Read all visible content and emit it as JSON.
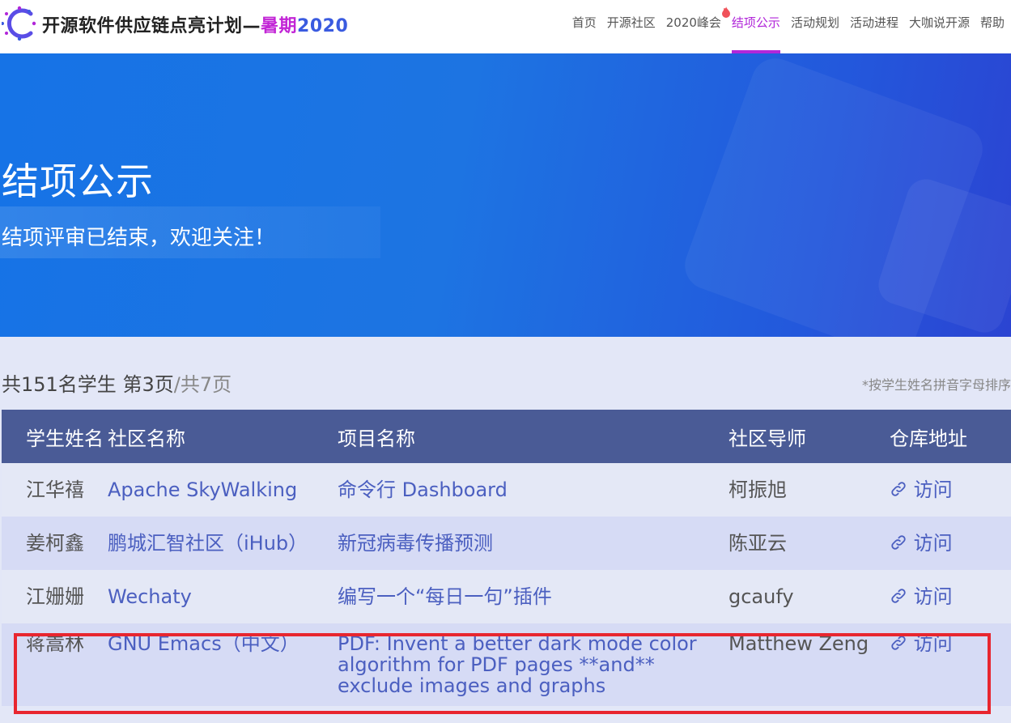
{
  "header": {
    "title_main": "开源软件供应链点亮计划",
    "title_dash": "—",
    "title_season": "暑期",
    "title_year": "2020",
    "nav": [
      {
        "label": "首页",
        "active": false
      },
      {
        "label": "开源社区",
        "active": false
      },
      {
        "label": "2020峰会",
        "active": false,
        "hot": true
      },
      {
        "label": "结项公示",
        "active": true
      },
      {
        "label": "活动规划",
        "active": false
      },
      {
        "label": "活动进程",
        "active": false
      },
      {
        "label": "大咖说开源",
        "active": false
      },
      {
        "label": "帮助",
        "active": false
      }
    ]
  },
  "banner": {
    "title": "结项公示",
    "subtitle": "结项评审已结束，欢迎关注！"
  },
  "summary": {
    "students": "共151名学生",
    "page": "第3页",
    "total_pages": "/共7页",
    "sort_note": "*按学生姓名拼音字母排序"
  },
  "table": {
    "headers": [
      "学生姓名",
      "社区名称",
      "项目名称",
      "社区导师",
      "仓库地址"
    ],
    "rows": [
      {
        "student": "江华禧",
        "community": "Apache SkyWalking",
        "project": "命令行 Dashboard",
        "mentor": "柯振旭",
        "repo": "访问"
      },
      {
        "student": "姜柯鑫",
        "community": "鹏城汇智社区（iHub）",
        "project": "新冠病毒传播预测",
        "mentor": "陈亚云",
        "repo": "访问"
      },
      {
        "student": "江姗姗",
        "community": "Wechaty",
        "project": "编写一个“每日一句”插件",
        "mentor": "gcaufy",
        "repo": "访问"
      },
      {
        "student": "蒋嵩林",
        "community": "GNU Emacs（中文）",
        "project": "PDF: Invent a better dark mode color algorithm for PDF pages **and** exclude images and graphs",
        "mentor": "Matthew Zeng",
        "repo": "访问"
      }
    ]
  },
  "colors": {
    "accent": "#b126d9",
    "table_header": "#4a5b96",
    "link": "#4b5fc0",
    "highlight_border": "#e8262f"
  }
}
